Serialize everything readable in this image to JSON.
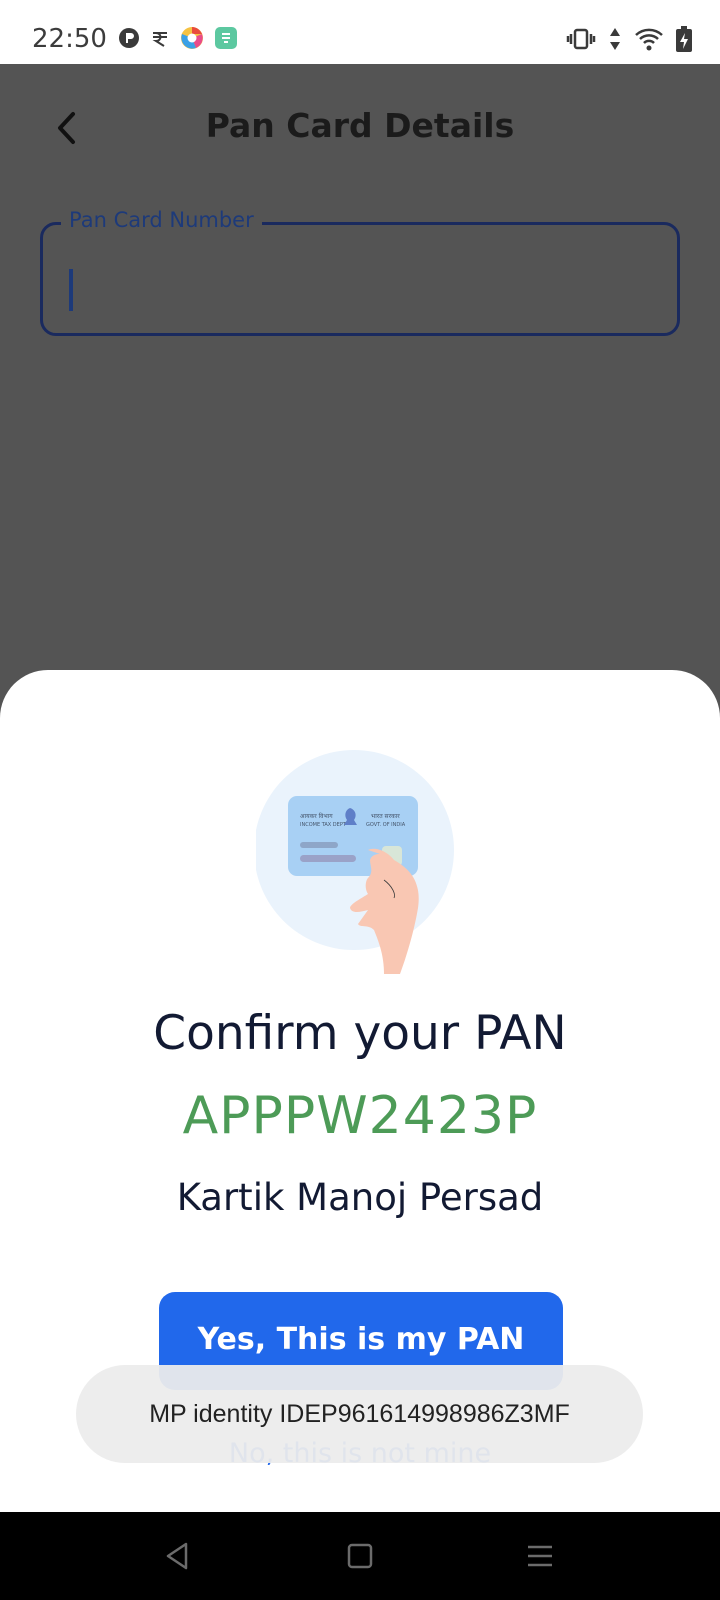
{
  "status_bar": {
    "time": "22:50",
    "notification_icons": [
      "podcast-app-icon",
      "rupee-app-icon",
      "chrome-style-app-icon",
      "green-app-icon"
    ],
    "system_icons": [
      "vibrate-icon",
      "data-arrows-icon",
      "wifi-icon",
      "battery-charging-icon"
    ]
  },
  "header": {
    "title": "Pan Card Details",
    "back_icon": "chevron-left-icon"
  },
  "form": {
    "pan_label": "Pan Card Number",
    "pan_value": ""
  },
  "sheet": {
    "illustration": "pan-card-in-hand-icon",
    "card_text_left": "आयकर विभाग",
    "card_text_left_en": "INCOME TAX DEPT",
    "card_text_right": "भारत सरकार",
    "card_text_right_en": "GOVT. OF INDIA",
    "title": "Confirm your PAN",
    "pan_number": "APPPW2423P",
    "holder_name": "Kartik Manoj Persad",
    "yes_label": "Yes, This is my PAN",
    "no_label": "No, this is not mine"
  },
  "toast": {
    "text": "MP identity IDEP961614998986Z3MF"
  },
  "nav_bar": {
    "back_icon": "triangle-back-icon",
    "home_icon": "square-home-icon",
    "menu_icon": "menu-lines-icon"
  },
  "colors": {
    "accent": "#2168eb",
    "pan_green": "#4d9b57",
    "scrim": "#545454"
  }
}
